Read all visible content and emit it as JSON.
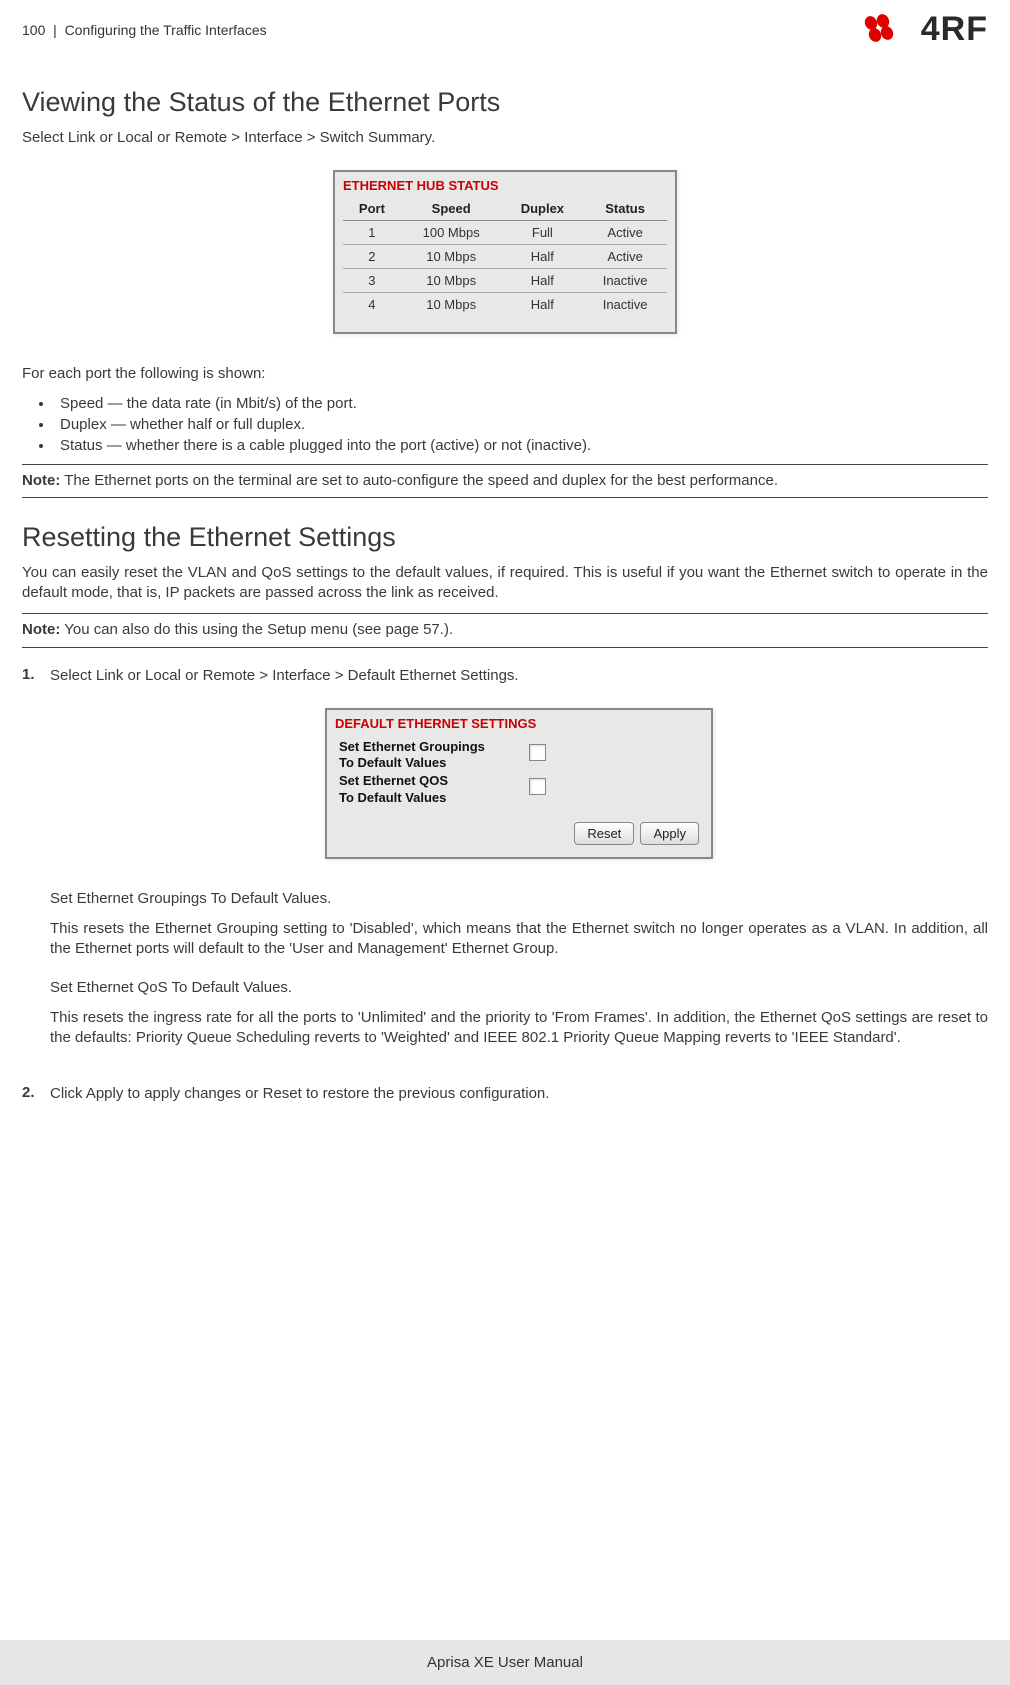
{
  "header": {
    "page_num": "100",
    "separator": "|",
    "chapter": "Configuring the Traffic Interfaces",
    "brand": "4RF"
  },
  "h1_1": "Viewing the Status of the Ethernet Ports",
  "p1": "Select Link or Local or Remote > Interface > Switch Summary.",
  "ss1": {
    "title": "ETHERNET HUB STATUS",
    "headers": {
      "c1": "Port",
      "c2": "Speed",
      "c3": "Duplex",
      "c4": "Status"
    },
    "rows": [
      {
        "port": "1",
        "speed": "100 Mbps",
        "duplex": "Full",
        "status": "Active"
      },
      {
        "port": "2",
        "speed": "10 Mbps",
        "duplex": "Half",
        "status": "Active"
      },
      {
        "port": "3",
        "speed": "10 Mbps",
        "duplex": "Half",
        "status": "Inactive"
      },
      {
        "port": "4",
        "speed": "10 Mbps",
        "duplex": "Half",
        "status": "Inactive"
      }
    ]
  },
  "p2": "For each port the following is shown:",
  "bullets": {
    "b1": "Speed — the data rate (in Mbit/s) of the port.",
    "b2": "Duplex — whether half or full duplex.",
    "b3": "Status — whether there is a cable plugged into the port (active) or not (inactive)."
  },
  "note1": {
    "label": "Note:",
    "text": " The Ethernet ports on the terminal are set to auto-configure the speed and duplex for the best performance."
  },
  "h1_2": "Resetting the Ethernet Settings",
  "p3": "You can easily reset the VLAN and QoS settings to the default values, if required. This is useful if you want the Ethernet switch to operate in the default mode, that is, IP packets are passed across the link as received.",
  "note2": {
    "label": "Note:",
    "text": " You can also do this using the Setup menu (see page 57.)."
  },
  "step1": "Select Link or Local or Remote > Interface > Default Ethernet Settings.",
  "ss2": {
    "title": "DEFAULT ETHERNET SETTINGS",
    "row1a": "Set Ethernet Groupings",
    "row1b": "To Default Values",
    "row2a": "Set Ethernet QOS",
    "row2b": "To Default Values",
    "reset": "Reset",
    "apply": "Apply"
  },
  "p4_title": "Set Ethernet Groupings To Default Values.",
  "p4_body": "This resets the Ethernet Grouping setting to 'Disabled', which means that the Ethernet switch no longer operates as a VLAN. In addition, all the Ethernet ports will default to the 'User and Management' Ethernet Group.",
  "p5_title": "Set Ethernet QoS To Default Values.",
  "p5_body": "This resets the ingress rate for all the ports to 'Unlimited' and the priority to 'From Frames'. In addition, the Ethernet QoS settings are reset to the defaults: Priority Queue Scheduling reverts to 'Weighted' and IEEE 802.1 Priority Queue Mapping reverts to 'IEEE Standard'.",
  "step2": "Click Apply to apply changes or Reset to restore the previous configuration.",
  "footer": "Aprisa XE User Manual"
}
